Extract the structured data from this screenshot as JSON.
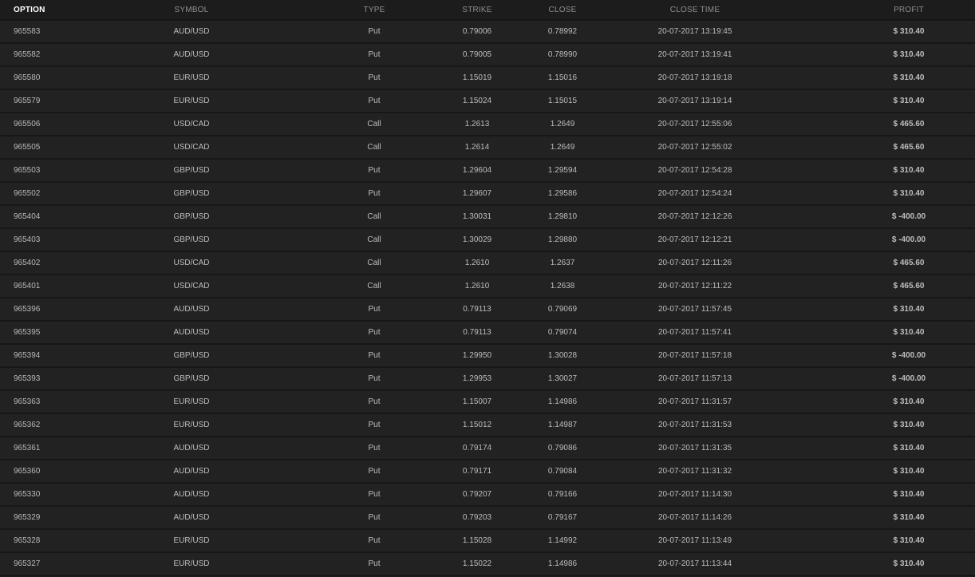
{
  "headers": {
    "option": "OPTION",
    "symbol": "SYMBOL",
    "type": "TYPE",
    "strike": "STRIKE",
    "close": "CLOSE",
    "close_time": "CLOSE TIME",
    "profit": "PROFIT"
  },
  "colors": {
    "profit_positive": "#33b23a",
    "profit_negative": "#d23a2e",
    "background": "#1b1b1b",
    "row_background": "#222222"
  },
  "rows": [
    {
      "option": "965583",
      "symbol": "AUD/USD",
      "type": "Put",
      "strike": "0.79006",
      "close": "0.78992",
      "close_time": "20-07-2017 13:19:45",
      "profit": "$ 310.40",
      "positive": true
    },
    {
      "option": "965582",
      "symbol": "AUD/USD",
      "type": "Put",
      "strike": "0.79005",
      "close": "0.78990",
      "close_time": "20-07-2017 13:19:41",
      "profit": "$ 310.40",
      "positive": true
    },
    {
      "option": "965580",
      "symbol": "EUR/USD",
      "type": "Put",
      "strike": "1.15019",
      "close": "1.15016",
      "close_time": "20-07-2017 13:19:18",
      "profit": "$ 310.40",
      "positive": true
    },
    {
      "option": "965579",
      "symbol": "EUR/USD",
      "type": "Put",
      "strike": "1.15024",
      "close": "1.15015",
      "close_time": "20-07-2017 13:19:14",
      "profit": "$ 310.40",
      "positive": true
    },
    {
      "option": "965506",
      "symbol": "USD/CAD",
      "type": "Call",
      "strike": "1.2613",
      "close": "1.2649",
      "close_time": "20-07-2017 12:55:06",
      "profit": "$ 465.60",
      "positive": true
    },
    {
      "option": "965505",
      "symbol": "USD/CAD",
      "type": "Call",
      "strike": "1.2614",
      "close": "1.2649",
      "close_time": "20-07-2017 12:55:02",
      "profit": "$ 465.60",
      "positive": true
    },
    {
      "option": "965503",
      "symbol": "GBP/USD",
      "type": "Put",
      "strike": "1.29604",
      "close": "1.29594",
      "close_time": "20-07-2017 12:54:28",
      "profit": "$ 310.40",
      "positive": true
    },
    {
      "option": "965502",
      "symbol": "GBP/USD",
      "type": "Put",
      "strike": "1.29607",
      "close": "1.29586",
      "close_time": "20-07-2017 12:54:24",
      "profit": "$ 310.40",
      "positive": true
    },
    {
      "option": "965404",
      "symbol": "GBP/USD",
      "type": "Call",
      "strike": "1.30031",
      "close": "1.29810",
      "close_time": "20-07-2017 12:12:26",
      "profit": "$ -400.00",
      "positive": false
    },
    {
      "option": "965403",
      "symbol": "GBP/USD",
      "type": "Call",
      "strike": "1.30029",
      "close": "1.29880",
      "close_time": "20-07-2017 12:12:21",
      "profit": "$ -400.00",
      "positive": false
    },
    {
      "option": "965402",
      "symbol": "USD/CAD",
      "type": "Call",
      "strike": "1.2610",
      "close": "1.2637",
      "close_time": "20-07-2017 12:11:26",
      "profit": "$ 465.60",
      "positive": true
    },
    {
      "option": "965401",
      "symbol": "USD/CAD",
      "type": "Call",
      "strike": "1.2610",
      "close": "1.2638",
      "close_time": "20-07-2017 12:11:22",
      "profit": "$ 465.60",
      "positive": true
    },
    {
      "option": "965396",
      "symbol": "AUD/USD",
      "type": "Put",
      "strike": "0.79113",
      "close": "0.79069",
      "close_time": "20-07-2017 11:57:45",
      "profit": "$ 310.40",
      "positive": true
    },
    {
      "option": "965395",
      "symbol": "AUD/USD",
      "type": "Put",
      "strike": "0.79113",
      "close": "0.79074",
      "close_time": "20-07-2017 11:57:41",
      "profit": "$ 310.40",
      "positive": true
    },
    {
      "option": "965394",
      "symbol": "GBP/USD",
      "type": "Put",
      "strike": "1.29950",
      "close": "1.30028",
      "close_time": "20-07-2017 11:57:18",
      "profit": "$ -400.00",
      "positive": false
    },
    {
      "option": "965393",
      "symbol": "GBP/USD",
      "type": "Put",
      "strike": "1.29953",
      "close": "1.30027",
      "close_time": "20-07-2017 11:57:13",
      "profit": "$ -400.00",
      "positive": false
    },
    {
      "option": "965363",
      "symbol": "EUR/USD",
      "type": "Put",
      "strike": "1.15007",
      "close": "1.14986",
      "close_time": "20-07-2017 11:31:57",
      "profit": "$ 310.40",
      "positive": true
    },
    {
      "option": "965362",
      "symbol": "EUR/USD",
      "type": "Put",
      "strike": "1.15012",
      "close": "1.14987",
      "close_time": "20-07-2017 11:31:53",
      "profit": "$ 310.40",
      "positive": true
    },
    {
      "option": "965361",
      "symbol": "AUD/USD",
      "type": "Put",
      "strike": "0.79174",
      "close": "0.79086",
      "close_time": "20-07-2017 11:31:35",
      "profit": "$ 310.40",
      "positive": true
    },
    {
      "option": "965360",
      "symbol": "AUD/USD",
      "type": "Put",
      "strike": "0.79171",
      "close": "0.79084",
      "close_time": "20-07-2017 11:31:32",
      "profit": "$ 310.40",
      "positive": true
    },
    {
      "option": "965330",
      "symbol": "AUD/USD",
      "type": "Put",
      "strike": "0.79207",
      "close": "0.79166",
      "close_time": "20-07-2017 11:14:30",
      "profit": "$ 310.40",
      "positive": true
    },
    {
      "option": "965329",
      "symbol": "AUD/USD",
      "type": "Put",
      "strike": "0.79203",
      "close": "0.79167",
      "close_time": "20-07-2017 11:14:26",
      "profit": "$ 310.40",
      "positive": true
    },
    {
      "option": "965328",
      "symbol": "EUR/USD",
      "type": "Put",
      "strike": "1.15028",
      "close": "1.14992",
      "close_time": "20-07-2017 11:13:49",
      "profit": "$ 310.40",
      "positive": true
    },
    {
      "option": "965327",
      "symbol": "EUR/USD",
      "type": "Put",
      "strike": "1.15022",
      "close": "1.14986",
      "close_time": "20-07-2017 11:13:44",
      "profit": "$ 310.40",
      "positive": true
    }
  ]
}
